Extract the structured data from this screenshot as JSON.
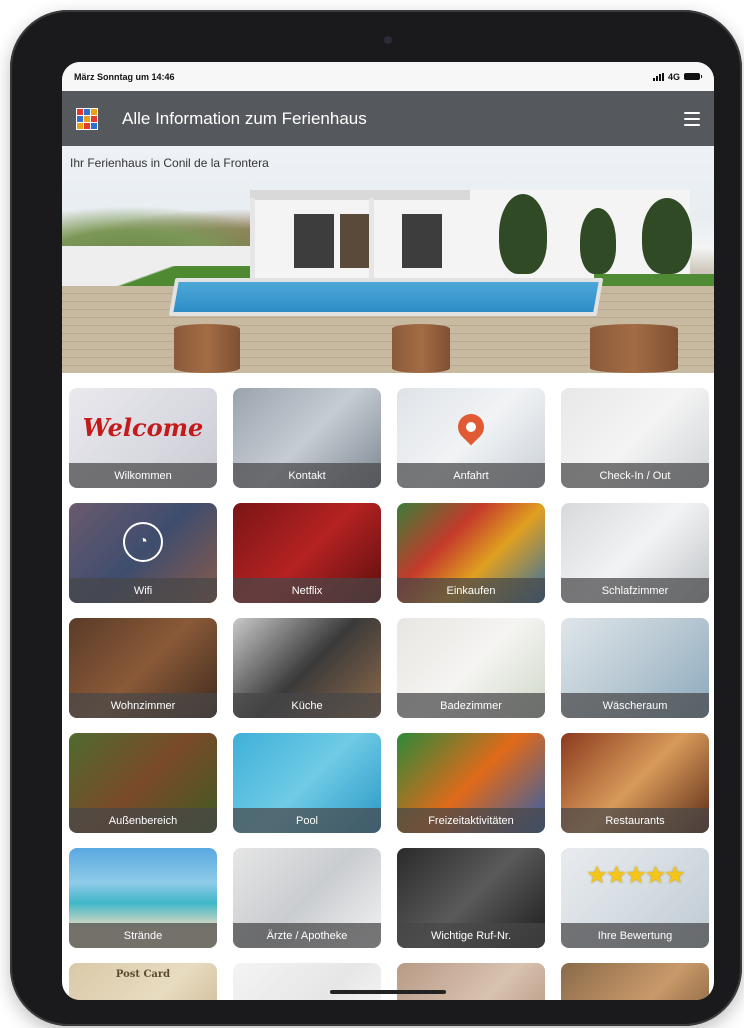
{
  "status_bar": {
    "time": "März Sonntag um 14:46",
    "network": "4G"
  },
  "header": {
    "title": "Alle Information zum Ferienhaus",
    "logo_icon": "app-logo-icon",
    "menu_icon": "hamburger-menu-icon"
  },
  "hero": {
    "caption": "Ihr Ferienhaus in Conil de la Frontera"
  },
  "tiles": [
    {
      "label": "Wilkommen",
      "bg": "linear-gradient(135deg,#e9e9ee,#d8d8e0 60%,#c9c9d2)",
      "icon": "welcome"
    },
    {
      "label": "Kontakt",
      "bg": "linear-gradient(135deg,#9aa3ad,#c6ccd3 50%,#7d8791)",
      "icon": "contact"
    },
    {
      "label": "Anfahrt",
      "bg": "linear-gradient(135deg,#dfe3e8,#f1f3f5 50%,#c9d0d8)",
      "icon": "pin"
    },
    {
      "label": "Check-In / Out",
      "bg": "linear-gradient(135deg,#e8e8e8,#f4f4f4 50%,#cfd3d6)",
      "icon": "key"
    },
    {
      "label": "Wifi",
      "bg": "linear-gradient(135deg,#6b5a6e,#3e4d6e 50%,#8a5a4a)",
      "icon": "wifi"
    },
    {
      "label": "Netflix",
      "bg": "linear-gradient(135deg,#7a1515,#b52222 50%,#5c0e0e)",
      "icon": "popcorn"
    },
    {
      "label": "Einkaufen",
      "bg": "linear-gradient(135deg,#3b7d3a,#c43a2a 35%,#e0a020 60%,#2f6fa8)",
      "icon": "food"
    },
    {
      "label": "Schlafzimmer",
      "bg": "linear-gradient(135deg,#d7d9dc,#f2f3f4 50%,#bfc3c7)",
      "icon": "bed"
    },
    {
      "label": "Wohnzimmer",
      "bg": "linear-gradient(135deg,#5a3a28,#8a5a38 50%,#3e2a1e)",
      "icon": "coffee"
    },
    {
      "label": "Küche",
      "bg": "linear-gradient(135deg,#c9c9c9,#3a3a3a 50%,#8f6a4a)",
      "icon": "pan"
    },
    {
      "label": "Badezimmer",
      "bg": "linear-gradient(135deg,#e8e6e2,#f5f4f2 50%,#cfd8c8)",
      "icon": "towel"
    },
    {
      "label": "Wäscheraum",
      "bg": "linear-gradient(135deg,#dfe6ea,#b9c9d3 50%,#8aa9bd)",
      "icon": "laundry"
    },
    {
      "label": "Außenbereich",
      "bg": "linear-gradient(135deg,#4f6a2e,#7a4a2a 50%,#3f5a24)",
      "icon": "garden"
    },
    {
      "label": "Pool",
      "bg": "linear-gradient(135deg,#3fb0d8,#6fcbe6 50%,#2a97c4)",
      "icon": "water"
    },
    {
      "label": "Freizeitaktivitäten",
      "bg": "linear-gradient(135deg,#2c8a3a,#e06a1a 50%,#2a5fb0)",
      "icon": "ball"
    },
    {
      "label": "Restaurants",
      "bg": "linear-gradient(135deg,#8a3a1e,#d89a5a 50%,#5a2a16)",
      "icon": "pizza"
    },
    {
      "label": "Strände",
      "bg": "linear-gradient(180deg,#5aa8e0 0%,#8fcbe8 35%,#3fb7c8 55%,#e8dcc2 80%)",
      "icon": "beach"
    },
    {
      "label": "Ärzte / Apotheke",
      "bg": "linear-gradient(135deg,#e6e6e6,#c9ccd0 50%,#f3f3f3)",
      "icon": "doctor"
    },
    {
      "label": "Wichtige Ruf-Nr.",
      "bg": "linear-gradient(135deg,#2a2a2a,#5a5a5a 50%,#1c1c1c)",
      "icon": "phone"
    },
    {
      "label": "Ihre Bewertung",
      "bg": "linear-gradient(135deg,#e9ecef,#d5dde3 50%,#bfc9d1)",
      "icon": "stars",
      "stars": "★★★★★"
    },
    {
      "label": "",
      "bg": "linear-gradient(135deg,#d9c9a8,#e8dcc0 50%,#c2ad86)",
      "icon": "postcard"
    },
    {
      "label": "",
      "bg": "linear-gradient(135deg,#f4f4f4,#e6e6e6 50%,#ffffff)",
      "icon": "notes"
    },
    {
      "label": "",
      "bg": "linear-gradient(135deg,#b89a86,#d8c2b0 50%,#a8876f)",
      "icon": "laptop"
    },
    {
      "label": "",
      "bg": "linear-gradient(135deg,#8a6a4a,#c99a6a 50%,#6a4a2e)",
      "icon": "bread"
    }
  ],
  "partial_row_texts": {
    "postcard": "Post Card"
  },
  "welcome_text": "Welcome"
}
